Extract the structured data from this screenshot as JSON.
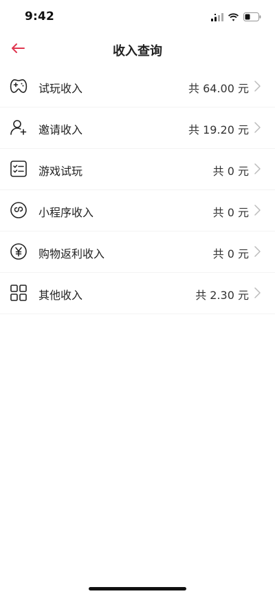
{
  "status_bar": {
    "time": "9:42",
    "icons": [
      "signal-icon",
      "wifi-icon",
      "battery-icon"
    ]
  },
  "header": {
    "title": "收入查询",
    "back_icon": "arrow-left-icon",
    "back_icon_color": "#e0364f"
  },
  "income_items": [
    {
      "icon": "gamepad-icon",
      "label": "试玩收入",
      "amount": "共 64.00 元"
    },
    {
      "icon": "user-add-icon",
      "label": "邀请收入",
      "amount": "共 19.20 元"
    },
    {
      "icon": "checklist-icon",
      "label": "游戏试玩",
      "amount": "共 0 元"
    },
    {
      "icon": "mini-program-icon",
      "label": "小程序收入",
      "amount": "共 0 元"
    },
    {
      "icon": "yuan-icon",
      "label": "购物返利收入",
      "amount": "共 0 元"
    },
    {
      "icon": "grid-icon",
      "label": "其他收入",
      "amount": "共 2.30 元"
    }
  ],
  "colors": {
    "text": "#222222",
    "chevron": "#bbbbbb",
    "divider": "#f3f3f3"
  }
}
